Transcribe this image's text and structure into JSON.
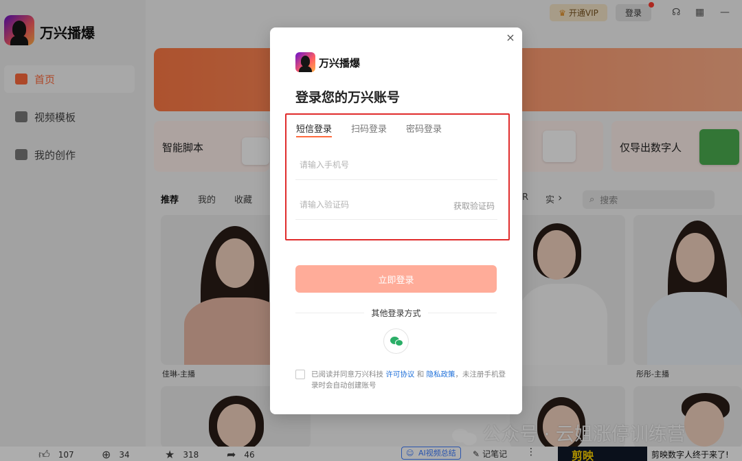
{
  "app": {
    "name": "万兴播爆"
  },
  "topbar": {
    "vip_label": "开通VIP",
    "login_label": "登录"
  },
  "sidebar": {
    "items": [
      {
        "label": "首页",
        "active": true
      },
      {
        "label": "视频模板",
        "active": false
      },
      {
        "label": "我的创作",
        "active": false
      }
    ]
  },
  "features": [
    {
      "label": "智能脚本"
    },
    {
      "label": "仅导出数字人"
    }
  ],
  "content_tabs": {
    "items": [
      "推荐",
      "我的",
      "收藏"
    ],
    "partial_items": [
      "R",
      "实"
    ],
    "next_arrow": "›"
  },
  "search": {
    "placeholder": "搜索"
  },
  "avatars": [
    {
      "name": "佳琳-主播"
    },
    {
      "name": "彤彤-主播"
    }
  ],
  "bottom_bar": {
    "likes": "107",
    "coins": "34",
    "favorites": "318",
    "shares": "46",
    "ai_summary": "AI视频总结",
    "notes": "记笔记",
    "more": "⋮",
    "promo_text": "剪映数字人终于来了!",
    "promo_image_text": "剪映"
  },
  "watermark": {
    "text": "公众号 · 云姐涨停训练营"
  },
  "login_modal": {
    "brand": "万兴播爆",
    "title": "登录您的万兴账号",
    "close": "×",
    "tabs": [
      {
        "label": "短信登录",
        "active": true
      },
      {
        "label": "扫码登录",
        "active": false
      },
      {
        "label": "密码登录",
        "active": false
      }
    ],
    "phone_placeholder": "请输入手机号",
    "code_placeholder": "请输入验证码",
    "get_code": "获取验证码",
    "submit": "立即登录",
    "other_methods": "其他登录方式",
    "agreement": {
      "prefix": "已阅读并同意万兴科技",
      "terms_link": "许可协议",
      "and": "和",
      "privacy_link": "隐私政策",
      "suffix": "，未注册手机登录时会自动创建账号"
    }
  },
  "colors": {
    "accent": "#ff6a3d",
    "submit_disabled": "#ffac99",
    "highlight_frame": "#e02b2b",
    "link": "#1e6fd9",
    "wechat": "#2aae67"
  }
}
